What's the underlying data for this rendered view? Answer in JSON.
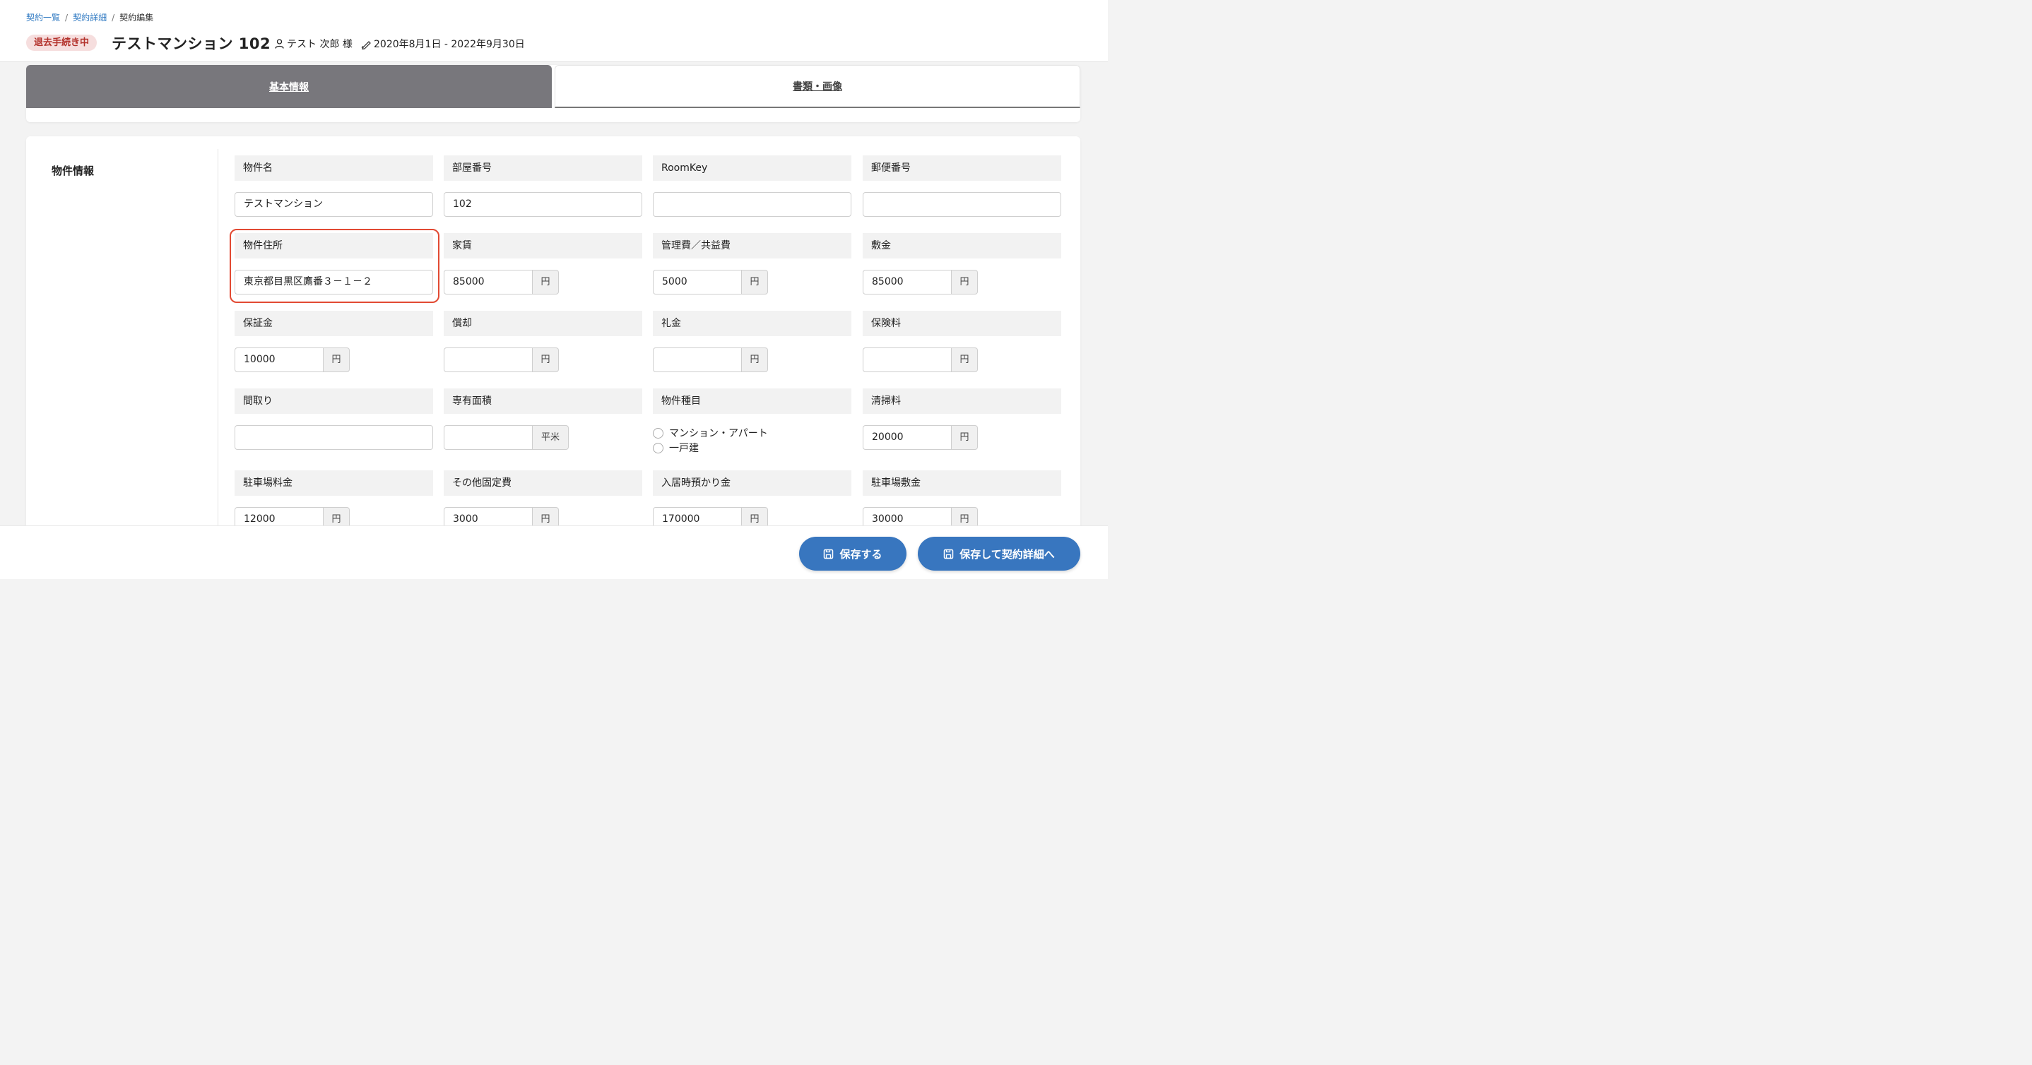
{
  "breadcrumb": {
    "items": [
      "契約一覧",
      "契約詳細"
    ],
    "current": "契約編集"
  },
  "header": {
    "status": "退去手続き中",
    "title": "テストマンション 102",
    "tenant": "テスト 次郎 様",
    "period": "2020年8月1日 - 2022年9月30日"
  },
  "tabs": [
    {
      "label": "基本情報",
      "active": true
    },
    {
      "label": "書類・画像",
      "active": false
    }
  ],
  "section": {
    "title": "物件情報"
  },
  "fields": {
    "property_name": {
      "label": "物件名",
      "value": "テストマンション"
    },
    "room_number": {
      "label": "部屋番号",
      "value": "102"
    },
    "roomkey": {
      "label": "RoomKey",
      "value": ""
    },
    "postal_code": {
      "label": "郵便番号",
      "value": ""
    },
    "address": {
      "label": "物件住所",
      "value": "東京都目黒区鷹番３－１－２"
    },
    "rent": {
      "label": "家賃",
      "value": "85000",
      "unit": "円"
    },
    "management_fee": {
      "label": "管理費／共益費",
      "value": "5000",
      "unit": "円"
    },
    "deposit": {
      "label": "敷金",
      "value": "85000",
      "unit": "円"
    },
    "guarantee": {
      "label": "保証金",
      "value": "10000",
      "unit": "円"
    },
    "amortization": {
      "label": "償却",
      "value": "",
      "unit": "円"
    },
    "key_money": {
      "label": "礼金",
      "value": "",
      "unit": "円"
    },
    "insurance": {
      "label": "保険料",
      "value": "",
      "unit": "円"
    },
    "floor_plan": {
      "label": "間取り",
      "value": ""
    },
    "area": {
      "label": "専有面積",
      "value": "",
      "unit": "平米"
    },
    "property_type": {
      "label": "物件種目",
      "options": [
        "マンション・アパート",
        "一戸建"
      ]
    },
    "cleaning_fee": {
      "label": "清掃料",
      "value": "20000",
      "unit": "円"
    },
    "parking_fee": {
      "label": "駐車場料金",
      "value": "12000",
      "unit": "円"
    },
    "other_fixed": {
      "label": "その他固定費",
      "value": "3000",
      "unit": "円"
    },
    "move_in_deposit": {
      "label": "入居時預かり金",
      "value": "170000",
      "unit": "円"
    },
    "parking_deposit": {
      "label": "駐車場敷金",
      "value": "30000",
      "unit": "円"
    }
  },
  "footer": {
    "save_label": "保存する",
    "save_detail_label": "保存して契約詳細へ"
  },
  "colors": {
    "accent": "#3876bf",
    "status_bg": "#f6dede",
    "status_text": "#b3312b",
    "active_tab": "#78777c",
    "highlight": "#e24a33"
  }
}
